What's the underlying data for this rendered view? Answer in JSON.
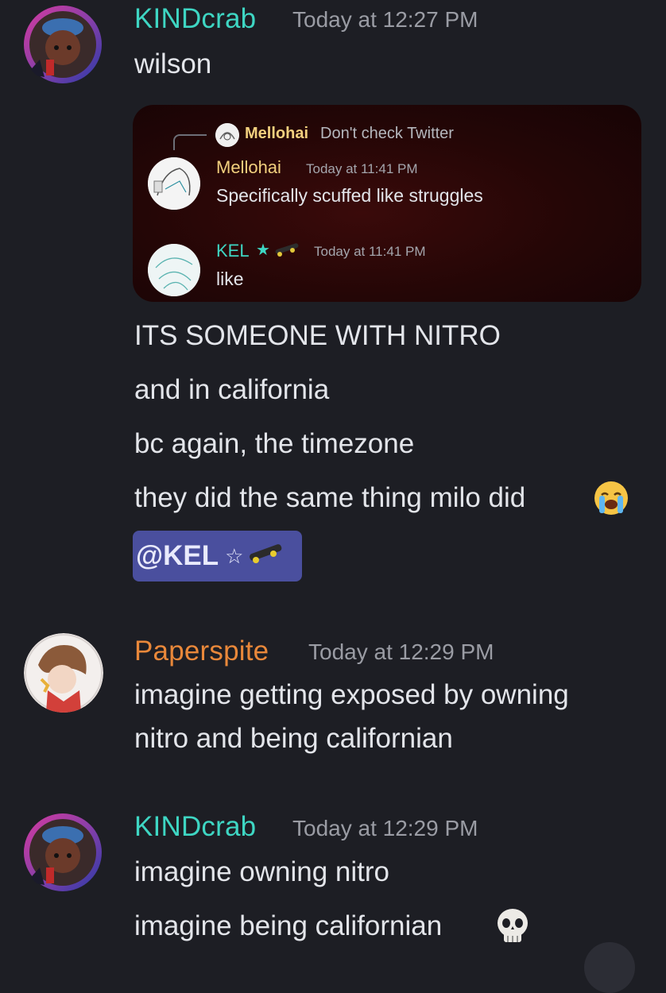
{
  "messages": [
    {
      "author": "KINDcrab",
      "author_color": "#3ed6c3",
      "time": "Today at 12:27 PM",
      "lines": [
        "wilson"
      ],
      "forward": {
        "reply_author": "Mellohai",
        "reply_text": "Don't check Twitter",
        "items": [
          {
            "author": "Mellohai",
            "author_color": "#f2d07e",
            "time": "Today at 11:41 PM",
            "text": "Specifically scuffed like struggles"
          },
          {
            "author": "KEL",
            "author_color": "#3ed6c3",
            "time": "Today at 11:41 PM",
            "text": "like"
          }
        ]
      },
      "after_lines": [
        "ITS SOMEONE WITH NITRO",
        "and in california",
        "bc again, the timezone",
        "they did the same thing milo did"
      ],
      "after_last_emoji": "crying-face",
      "mention": "@KEL"
    },
    {
      "author": "Paperspite",
      "author_color": "#e9883a",
      "time": "Today at 12:29 PM",
      "lines": [
        "imagine getting exposed by owning",
        "nitro and being californian"
      ]
    },
    {
      "author": "KINDcrab",
      "author_color": "#3ed6c3",
      "time": "Today at 12:29 PM",
      "lines": [
        "imagine owning nitro",
        "imagine being californian"
      ],
      "last_emoji": "skull"
    }
  ]
}
